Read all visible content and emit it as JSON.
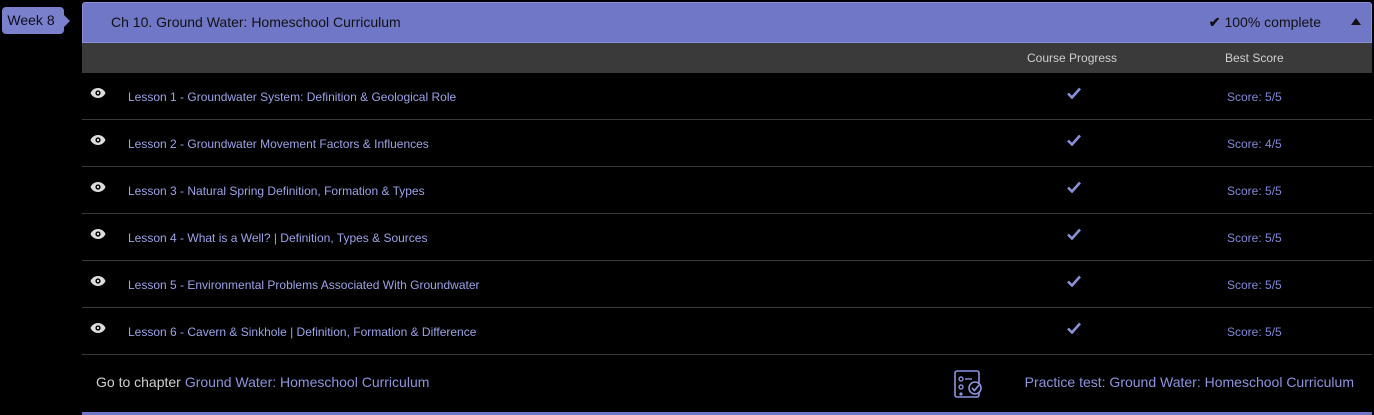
{
  "week": {
    "label": "Week 8"
  },
  "chapter": {
    "title": "Ch 10. Ground Water: Homeschool Curriculum",
    "completion": "100% complete"
  },
  "columns": {
    "progress": "Course Progress",
    "score": "Best Score"
  },
  "lessons": [
    {
      "title": "Lesson 1 - Groundwater System: Definition & Geological Role",
      "score": "Score: 5/5"
    },
    {
      "title": "Lesson 2 - Groundwater Movement Factors & Influences",
      "score": "Score: 4/5"
    },
    {
      "title": "Lesson 3 - Natural Spring Definition, Formation & Types",
      "score": "Score: 5/5"
    },
    {
      "title": "Lesson 4 - What is a Well? | Definition, Types & Sources",
      "score": "Score: 5/5"
    },
    {
      "title": "Lesson 5 - Environmental Problems Associated With Groundwater",
      "score": "Score: 5/5"
    },
    {
      "title": "Lesson 6 - Cavern & Sinkhole | Definition, Formation & Difference",
      "score": "Score: 5/5"
    }
  ],
  "footer": {
    "goto_prefix": "Go to chapter",
    "goto_link": "Ground Water: Homeschool Curriculum",
    "practice_link": "Practice test: Ground Water: Homeschool Curriculum"
  },
  "colors": {
    "accent": "#7077c6",
    "link": "#9ca2e6",
    "background": "#000000"
  },
  "icons": {
    "row_view": "eye-icon",
    "row_progress": "checkmark-icon",
    "practice": "practice-test-icon",
    "collapse": "caret-up-icon"
  }
}
